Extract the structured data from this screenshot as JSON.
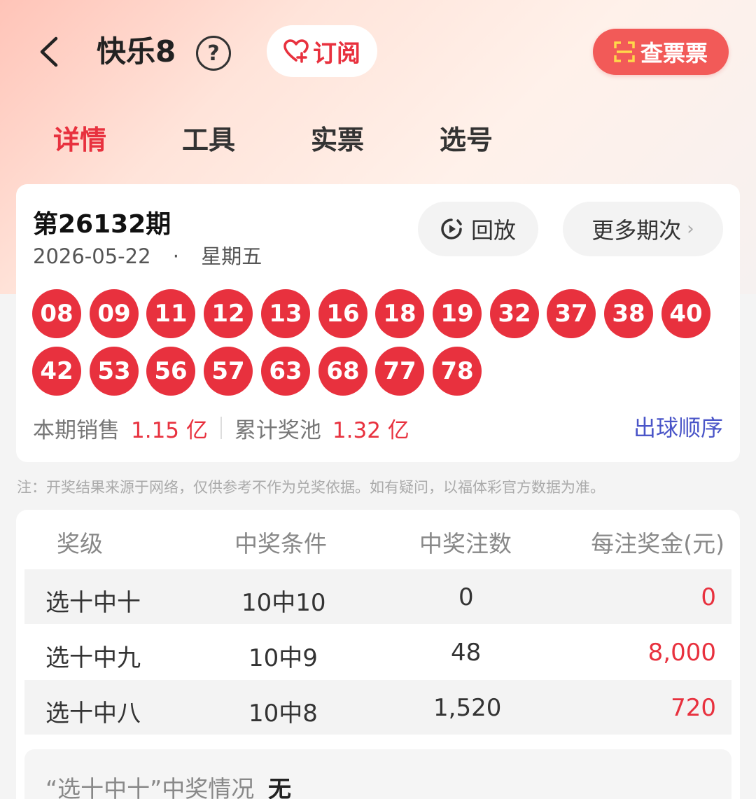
{
  "header": {
    "title": "快乐8",
    "help_glyph": "?",
    "subscribe_label": "订阅",
    "check_ticket_label": "查票票"
  },
  "tabs": [
    {
      "label": "详情",
      "active": true
    },
    {
      "label": "工具",
      "active": false
    },
    {
      "label": "实票",
      "active": false
    },
    {
      "label": "选号",
      "active": false
    }
  ],
  "draw": {
    "issue": "第26132期",
    "date": "2026-05-22",
    "date_sep": "·",
    "weekday": "星期五",
    "replay_label": "回放",
    "more_label": "更多期次",
    "numbers": [
      "08",
      "09",
      "11",
      "12",
      "13",
      "16",
      "18",
      "19",
      "32",
      "37",
      "38",
      "40",
      "42",
      "53",
      "56",
      "57",
      "63",
      "68",
      "77",
      "78"
    ],
    "sales_label": "本期销售",
    "sales_value": "1.15 亿",
    "pool_label": "累计奖池",
    "pool_value": "1.32 亿",
    "order_link": "出球顺序"
  },
  "note": "注：开奖结果来源于网络，仅供参考不作为兑奖依据。如有疑问，以福体彩官方数据为准。",
  "prize_table": {
    "headers": [
      "奖级",
      "中奖条件",
      "中奖注数",
      "每注奖金(元)"
    ],
    "rows": [
      {
        "level": "选十中十",
        "condition": "10中10",
        "count": "0",
        "amount": "0"
      },
      {
        "level": "选十中九",
        "condition": "10中9",
        "count": "48",
        "amount": "8,000"
      },
      {
        "level": "选十中八",
        "condition": "10中8",
        "count": "1,520",
        "amount": "720"
      }
    ]
  },
  "summary": {
    "label": "“选十中十”中奖情况",
    "value": "无"
  },
  "colors": {
    "accent_red": "#e8313e",
    "link_blue": "#4a55c8",
    "ticket_button": "#f25a58"
  }
}
